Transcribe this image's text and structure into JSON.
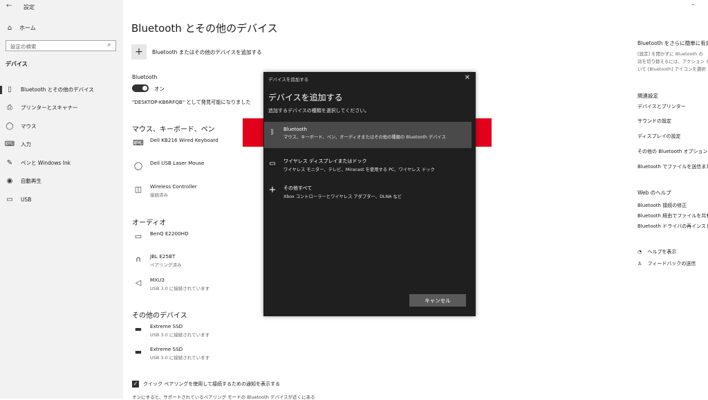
{
  "sidebar": {
    "back": "←",
    "title": "設定",
    "home": "ホーム",
    "search_placeholder": "設定の検索",
    "section": "デバイス",
    "items": [
      {
        "label": "Bluetooth とその他のデバイス",
        "icon": "bluetooth-devices-icon"
      },
      {
        "label": "プリンターとスキャナー",
        "icon": "printer-icon"
      },
      {
        "label": "マウス",
        "icon": "mouse-icon"
      },
      {
        "label": "入力",
        "icon": "keyboard-icon"
      },
      {
        "label": "ペンと Windows Ink",
        "icon": "pen-icon"
      },
      {
        "label": "自動再生",
        "icon": "autoplay-icon"
      },
      {
        "label": "USB",
        "icon": "usb-icon"
      }
    ]
  },
  "main": {
    "title": "Bluetooth とその他のデバイス",
    "add_device": "Bluetooth またはその他のデバイスを追加する",
    "bluetooth_label": "Bluetooth",
    "toggle_state": "オン",
    "discoverable": "\"DESKTOP-KB6RFQB\" として発見可能になりました",
    "groups": {
      "mouse_keyboard": "マウス、キーボード、ペン",
      "audio": "オーディオ",
      "other": "その他のデバイス"
    },
    "devices": {
      "keyboard": {
        "name": "Dell KB216 Wired Keyboard"
      },
      "mouse": {
        "name": "Dell USB Laser Mouse"
      },
      "controller": {
        "name": "Wireless Controller",
        "status": "接続済み"
      },
      "monitor": {
        "name": "BenQ E2200HD"
      },
      "headset": {
        "name": "JBL E25BT",
        "status": "ペアリング済み"
      },
      "mixer": {
        "name": "MXU3",
        "status": "USB 3.0 に接続されています"
      },
      "ssd1": {
        "name": "Extreme SSD",
        "status": "USB 3.0 に接続されています"
      },
      "ssd2": {
        "name": "Extreme SSD",
        "status": "USB 3.0 に接続されています"
      }
    },
    "swift_pair": "クイック ペアリングを使用して接続するための通知を表示する",
    "swift_pair_note": "オンにすると、サポートされているペアリング モードの Bluetooth デバイスが近くにある"
  },
  "right_panel": {
    "tip_title": "Bluetooth をさらに簡単に有効",
    "tip_lines": [
      "[設定] を開かずに Bluetooth の",
      "効を切り替えるには、アクション セ",
      "いて [Bluetooth] アイコンを選択"
    ],
    "related_title": "関連設定",
    "related": [
      "デバイスとプリンター",
      "サウンドの設定",
      "ディスプレイの設定",
      "その他の Bluetooth オプション",
      "Bluetooth でファイルを送信または"
    ],
    "help_title": "Web のヘルプ",
    "help": [
      "Bluetooth 接続の修正",
      "Bluetooth 経由でファイルを共有",
      "Bluetooth ドライバの再インストー"
    ],
    "get_help": "ヘルプを表示",
    "feedback": "フィードバックの送信",
    "minimize": "–"
  },
  "dialog": {
    "window_title": "デバイスを追加する",
    "close": "✕",
    "heading": "デバイスを追加する",
    "subtitle": "追加するデバイスの種類を選択してください。",
    "options": [
      {
        "name": "Bluetooth",
        "desc": "マウス、キーボード、ペン、オーディオまたはその他の種類の Bluetooth デバイス"
      },
      {
        "name": "ワイヤレス ディスプレイまたはドック",
        "desc": "ワイヤレス モニター、テレビ、Miracast を使用する PC、ワイヤレス ドック"
      },
      {
        "name": "その他すべて",
        "desc": "Xbox コントローラーとワイヤレス アダプター、DLNA など"
      }
    ],
    "cancel": "キャンセル"
  },
  "colors": {
    "highlight_band": "#e2001a",
    "dialog_bg": "#1f1f1f",
    "selected_option": "#4a4a4a"
  }
}
